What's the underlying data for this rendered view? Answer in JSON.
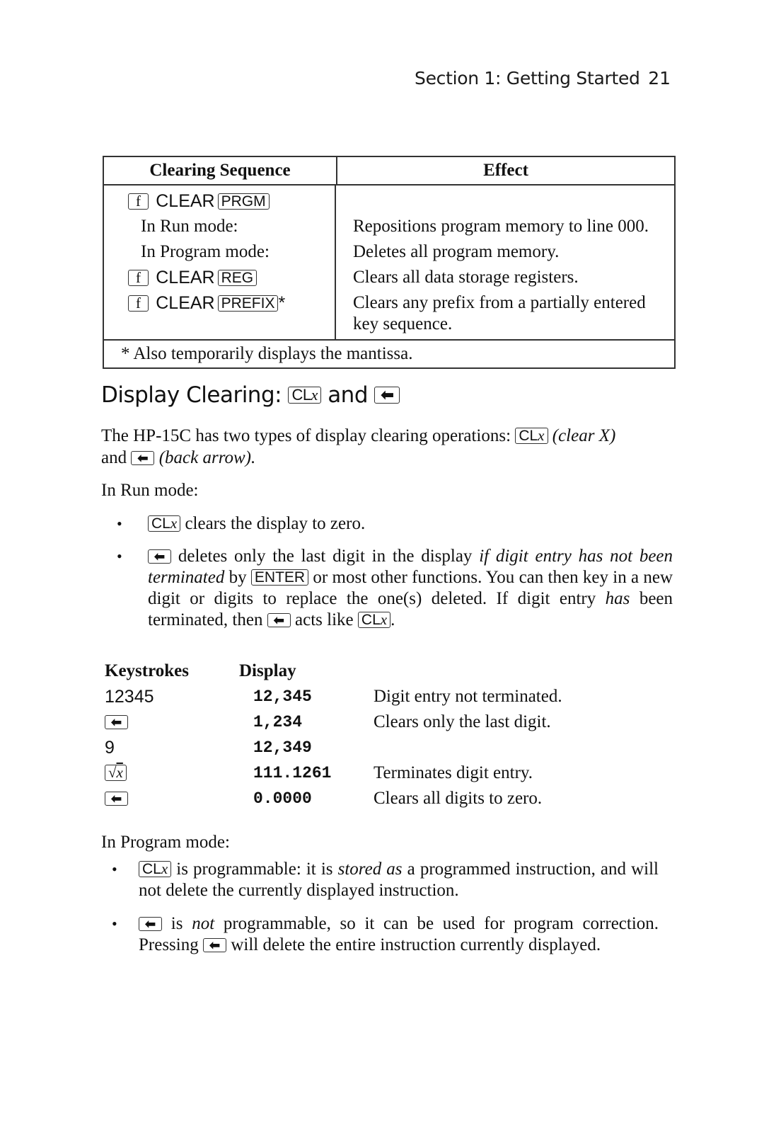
{
  "running_head": {
    "section": "Section 1: Getting Started",
    "page_number": "21"
  },
  "clearing_table": {
    "headers": [
      "Clearing Sequence",
      "Effect"
    ],
    "rows": [
      {
        "prefix_key": "f",
        "word": "CLEAR",
        "key": "PRGM",
        "effect": ""
      },
      {
        "mode": "In Run mode:",
        "effect": "Repositions program memory to line 000."
      },
      {
        "mode": "In Program mode:",
        "effect": "Deletes all program memory."
      },
      {
        "prefix_key": "f",
        "word": "CLEAR",
        "key": "REG",
        "effect": "Clears all data storage registers."
      },
      {
        "prefix_key": "f",
        "word": "CLEAR",
        "key": "PREFIX",
        "suffix": "*",
        "effect": "Clears any prefix from a partially entered key sequence."
      }
    ],
    "footnote": "* Also temporarily displays the mantissa."
  },
  "heading": {
    "text": "Display Clearing:",
    "key1": "CL",
    "key1_var": "x",
    "conj": "and",
    "key2_icon": "back-arrow"
  },
  "intro": {
    "part1": "The HP-15C has two types of display clearing operations:",
    "clx_key": "CL",
    "clx_var": "x",
    "clx_desc": "(clear X)",
    "and": "and",
    "arrow_desc": "(back arrow)."
  },
  "run_mode": {
    "label": "In Run mode:",
    "bullet1": {
      "rest": "clears the display to zero."
    },
    "bullet2": {
      "part1": "deletes only the last digit in the display",
      "italic1": "if digit entry has not been terminated",
      "part2": "by",
      "enter_key": "ENTER",
      "part3": "or most other functions. You can then key in a new digit or digits to replace the one(s) deleted. If digit entry",
      "italic2": "has",
      "part4": "been terminated, then",
      "part5": "acts like",
      "end": "."
    }
  },
  "keystrokes_table": {
    "headers": [
      "Keystrokes",
      "Display"
    ],
    "rows": [
      {
        "keystroke": "12345",
        "keystroke_type": "digits",
        "display": "12,345",
        "note": "Digit entry not terminated."
      },
      {
        "keystroke": "back-arrow",
        "keystroke_type": "key",
        "display": "1,234",
        "note": "Clears only the last digit."
      },
      {
        "keystroke": "9",
        "keystroke_type": "digits",
        "display": "12,349",
        "note": ""
      },
      {
        "keystroke": "√x",
        "keystroke_type": "key",
        "display": "111.1261",
        "note": "Terminates digit entry."
      },
      {
        "keystroke": "back-arrow",
        "keystroke_type": "key",
        "display": "0.0000",
        "note": "Clears all digits to zero."
      }
    ]
  },
  "program_mode": {
    "label": "In Program mode:",
    "bullet1": {
      "part1": "is programmable: it is",
      "italic": "stored as",
      "part2": "a programmed instruction, and will not delete the currently displayed instruction."
    },
    "bullet2": {
      "part1": "is",
      "italic": "not",
      "part2": "programmable, so it can be used for program correction. Pressing",
      "part3": "will delete the entire instruction currently displayed."
    }
  },
  "glyphs": {
    "bullet": "•",
    "arrow": "⬅",
    "sqrt": "√"
  }
}
